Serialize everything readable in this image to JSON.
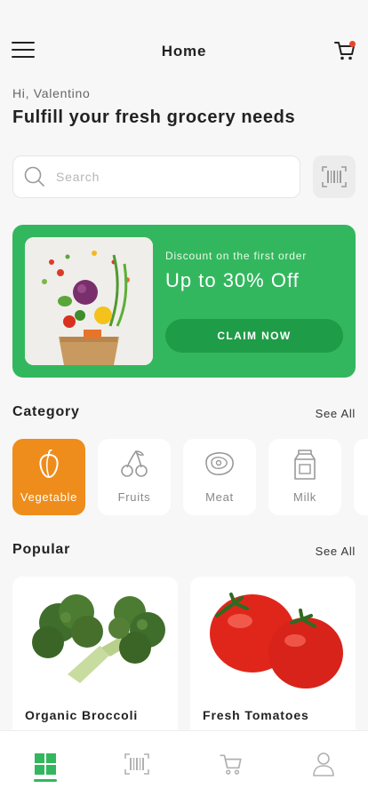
{
  "header": {
    "title": "Home",
    "menu_icon": "hamburger-menu-icon",
    "cart_icon": "shopping-cart-icon",
    "cart_badge_color": "#e8452c"
  },
  "greeting": "Hi, Valentino",
  "headline": "Fulfill your fresh grocery needs",
  "search": {
    "placeholder": "Search",
    "value": "",
    "icon": "search-icon",
    "scan_icon": "barcode-scan-icon"
  },
  "banner": {
    "subtitle": "Discount on the first order",
    "title": "Up to 30% Off",
    "button_label": "CLAIM NOW",
    "background_color": "#33b75e",
    "button_color": "#1f9c47"
  },
  "category": {
    "title": "Category",
    "see_all": "See All",
    "items": [
      {
        "label": "Vegetable",
        "icon": "pepper-icon",
        "active": true
      },
      {
        "label": "Fruits",
        "icon": "cherries-icon",
        "active": false
      },
      {
        "label": "Meat",
        "icon": "steak-icon",
        "active": false
      },
      {
        "label": "Milk",
        "icon": "milk-carton-icon",
        "active": false
      }
    ],
    "active_color": "#ee8d1b"
  },
  "popular": {
    "title": "Popular",
    "see_all": "See All",
    "items": [
      {
        "name": "Organic Broccoli"
      },
      {
        "name": "Fresh Tomatoes"
      }
    ]
  },
  "bottom_nav": {
    "items": [
      {
        "icon": "home-grid-icon",
        "active": true
      },
      {
        "icon": "barcode-scan-icon",
        "active": false
      },
      {
        "icon": "shopping-cart-icon",
        "active": false
      },
      {
        "icon": "user-profile-icon",
        "active": false
      }
    ],
    "active_color": "#33b75e"
  }
}
